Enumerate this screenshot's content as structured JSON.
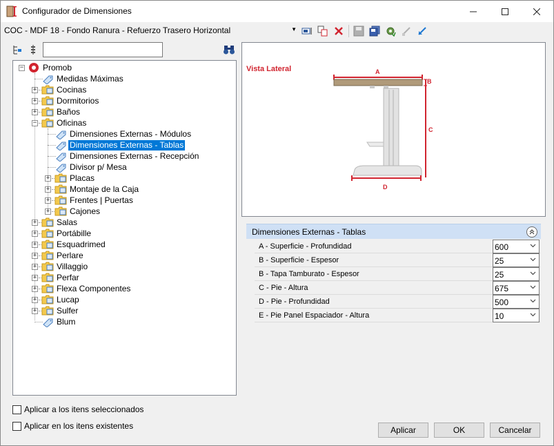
{
  "window": {
    "title": "Configurador de Dimensiones"
  },
  "toolbar": {
    "config_value": "COC - MDF 18 - Fondo Ranura - Refuerzo Trasero Horizontal"
  },
  "tree": {
    "root": "Promob",
    "items": [
      "Medidas Máximas",
      "Cocinas",
      "Dormitorios",
      "Baños",
      "Oficinas",
      "Dimensiones Externas - Módulos",
      "Dimensiones Externas - Tablas",
      "Dimensiones Externas - Recepción",
      "Divisor p/ Mesa",
      "Placas",
      "Montaje de la Caja",
      "Frentes | Puertas",
      "Cajones",
      "Salas",
      "Portábille",
      "Esquadrimed",
      "Perlare",
      "Villaggio",
      "Perfar",
      "Flexa Componentes",
      "Lucap",
      "Sulfer",
      "Blum"
    ]
  },
  "preview": {
    "view_label": "Vista Lateral",
    "dim_a": "A",
    "dim_b": "B",
    "dim_c": "C",
    "dim_d": "D",
    "colors": {
      "dimension": "#d1242f",
      "top": "#b09a7a",
      "metal": "#d9d9d9"
    }
  },
  "panel": {
    "title": "Dimensiones Externas - Tablas",
    "rows": [
      {
        "label": "A - Superficie - Profundidad",
        "value": "600"
      },
      {
        "label": "B - Superficie - Espesor",
        "value": "25"
      },
      {
        "label": "B - Tapa Tamburato - Espesor",
        "value": "25"
      },
      {
        "label": "C - Pie - Altura",
        "value": "675"
      },
      {
        "label": "D - Pie - Profundidad",
        "value": "500"
      },
      {
        "label": "E - Pie Panel Espaciador - Altura",
        "value": "10"
      }
    ]
  },
  "options": {
    "apply_selected": "Aplicar a los itens seleccionados",
    "apply_existing": "Aplicar en los itens existentes"
  },
  "buttons": {
    "apply": "Aplicar",
    "ok": "OK",
    "cancel": "Cancelar"
  },
  "accent": "#0078d7"
}
